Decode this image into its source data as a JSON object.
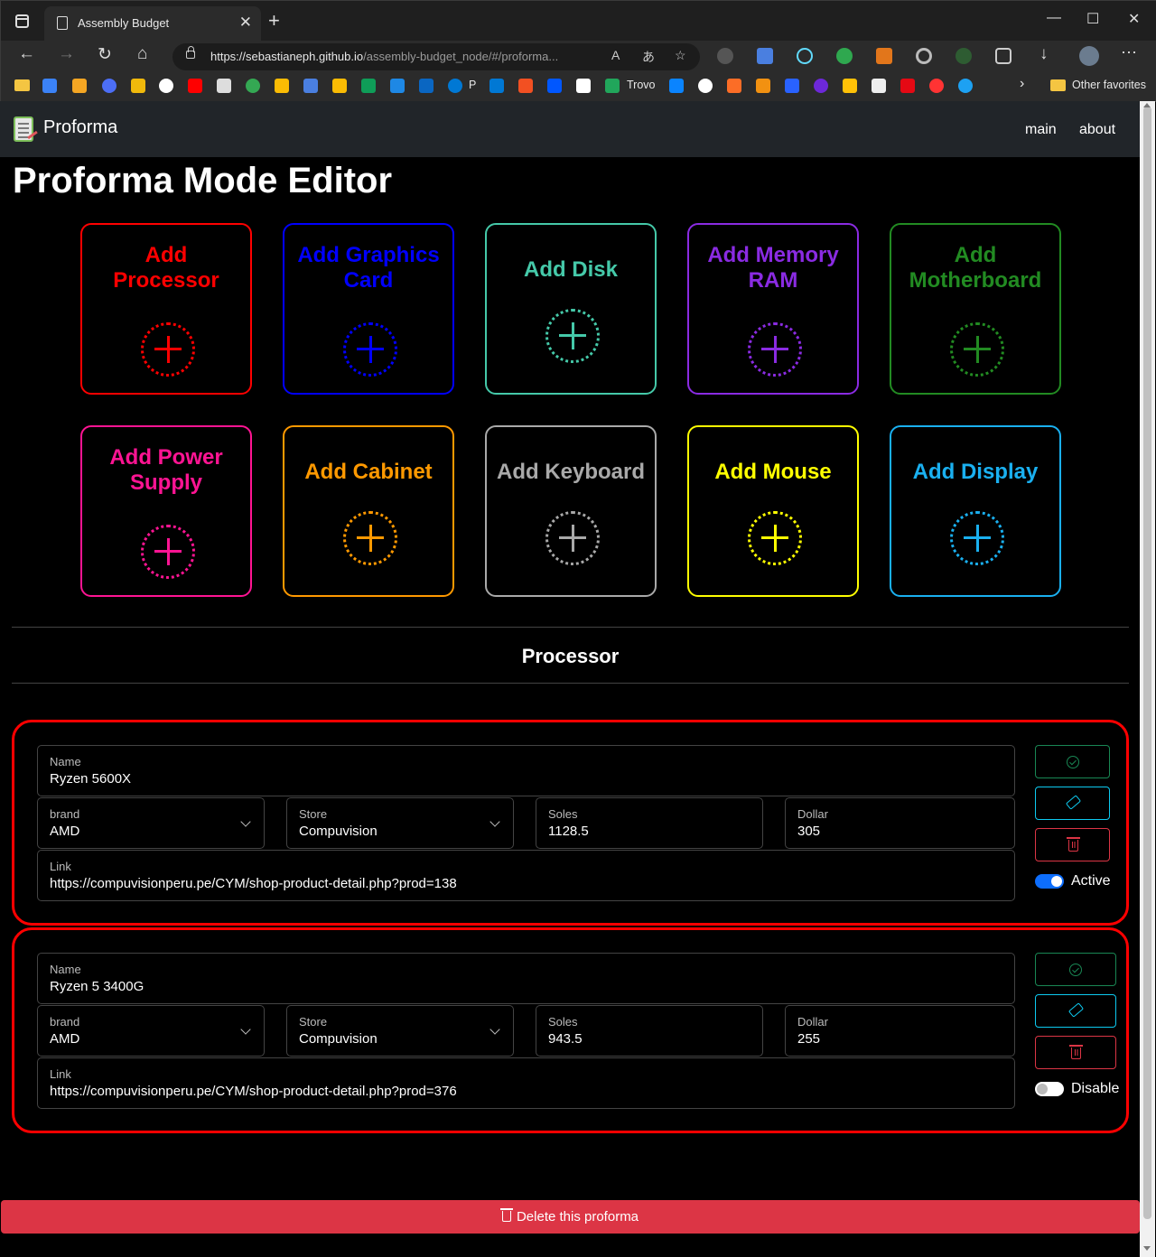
{
  "browser": {
    "tab_title": "Assembly Budget",
    "tab_close": "✕",
    "new_tab": "+",
    "url_domain": "https://sebastianeph.github.io",
    "url_path": "/assembly-budget_node/#/proforma...",
    "window_controls": [
      "—",
      "☐",
      "✕"
    ],
    "bookmark_trovo": "Trovo",
    "bookmark_p": "P",
    "other_favorites": "Other favorites"
  },
  "app": {
    "brand": "Proforma",
    "nav": [
      "main",
      "about"
    ],
    "page_title": "Proforma Mode Editor"
  },
  "cards": [
    {
      "label": "Add Processor",
      "color": "#ff0000"
    },
    {
      "label": "Add Graphics Card",
      "color": "#0000ff"
    },
    {
      "label": "Add Disk",
      "color": "#45c9a9"
    },
    {
      "label": "Add Memory RAM",
      "color": "#8a2be2"
    },
    {
      "label": "Add Motherboard",
      "color": "#228b22"
    },
    {
      "label": "Add Power Supply",
      "color": "#ff1493"
    },
    {
      "label": "Add Cabinet",
      "color": "#ff9900"
    },
    {
      "label": "Add Keyboard",
      "color": "#a9a9a9"
    },
    {
      "label": "Add Mouse",
      "color": "#ffff00"
    },
    {
      "label": "Add Display",
      "color": "#1ab0f0"
    }
  ],
  "section_title": "Processor",
  "items": [
    {
      "name_label": "Name",
      "name": "Ryzen 5600X",
      "brand_label": "brand",
      "brand": "AMD",
      "store_label": "Store",
      "store": "Compuvision",
      "soles_label": "Soles",
      "soles": "1128.5",
      "dollar_label": "Dollar",
      "dollar": "305",
      "link_label": "Link",
      "link": "https://compuvisionperu.pe/CYM/shop-product-detail.php?prod=138",
      "status": "Active",
      "active": true
    },
    {
      "name_label": "Name",
      "name": "Ryzen 5 3400G",
      "brand_label": "brand",
      "brand": "AMD",
      "store_label": "Store",
      "store": "Compuvision",
      "soles_label": "Soles",
      "soles": "943.5",
      "dollar_label": "Dollar",
      "dollar": "255",
      "link_label": "Link",
      "link": "https://compuvisionperu.pe/CYM/shop-product-detail.php?prod=376",
      "status": "Disable",
      "active": false
    }
  ],
  "delete_label": "Delete this proforma",
  "colors": {
    "danger": "#dc3545",
    "success": "#198754",
    "info": "#0dcaf0",
    "primary": "#0d6efd",
    "item_border": "#ff0000"
  }
}
